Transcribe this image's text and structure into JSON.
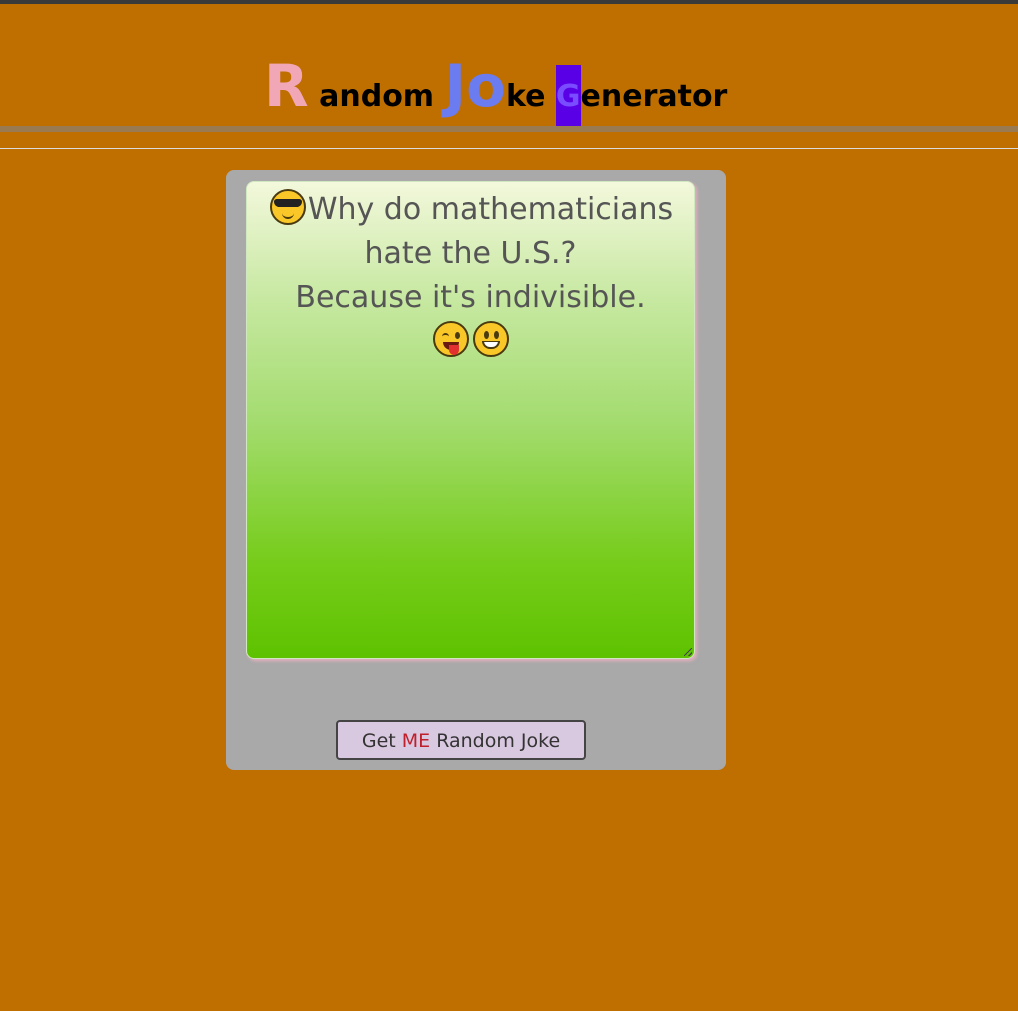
{
  "header": {
    "title_parts": [
      {
        "text": "R",
        "style": "big",
        "color": "#f2a7b6"
      },
      {
        "text": " andom ",
        "style": "small",
        "color": "#000000"
      },
      {
        "text": "Jo",
        "style": "big",
        "color": "#6b7bf0"
      },
      {
        "text": "ke ",
        "style": "small",
        "color": "#000000"
      },
      {
        "text": "G",
        "style": "small-highlight",
        "color": "#7a4cff",
        "highlight": "#5a00e6"
      },
      {
        "text": "enerator",
        "style": "small",
        "color": "#000000"
      }
    ]
  },
  "joke": {
    "leading_emoji": "cool-sunglasses-emoji",
    "lines": [
      "Why do mathematicians",
      "hate the U.S.?",
      "Because it's indivisible."
    ],
    "trailing_emojis": [
      "winking-tongue-emoji",
      "smiling-emoji"
    ]
  },
  "button": {
    "prefix": "Get ",
    "highlight": "ME",
    "suffix": " Random Joke",
    "highlight_color": "#c0202a"
  },
  "colors": {
    "background": "#bf6e00",
    "card": "#a9a9a9",
    "gradient_top": "#f3f8dc",
    "gradient_bottom": "#5ec200",
    "button_bg": "#d8c8e0"
  }
}
